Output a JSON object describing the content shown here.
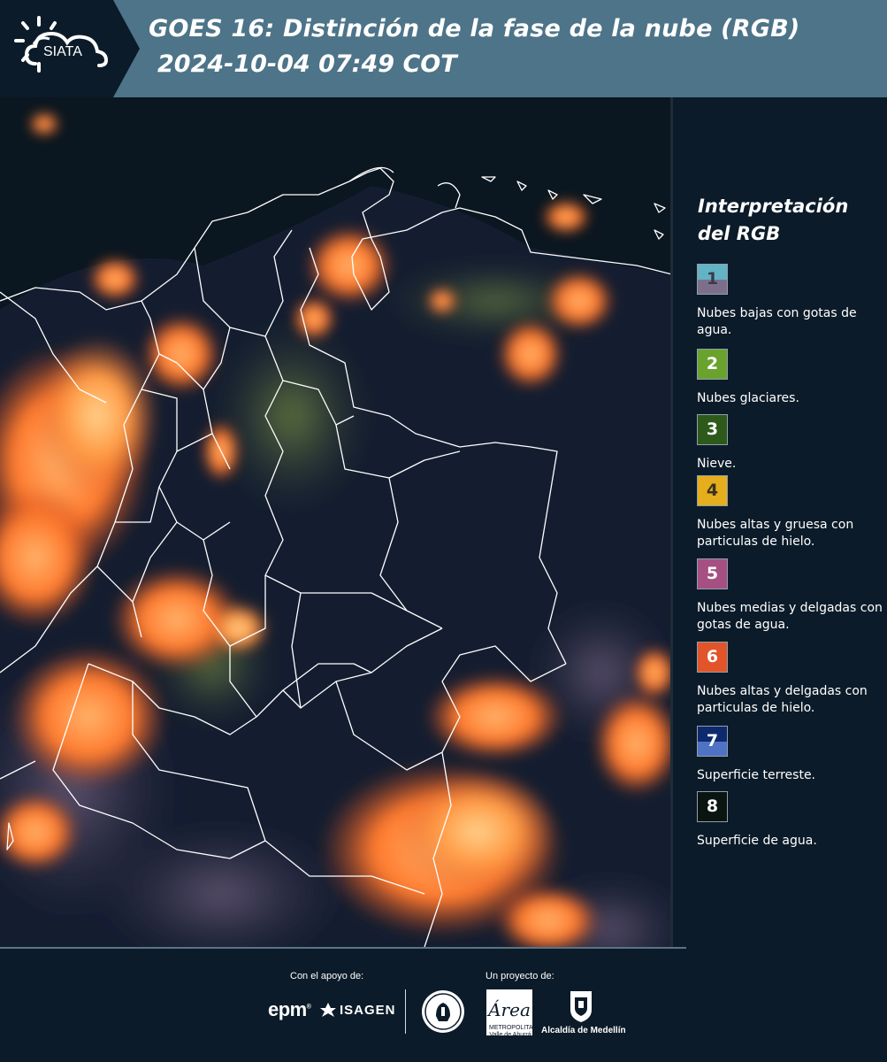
{
  "header": {
    "logo_text": "SIATA",
    "title": "GOES 16: Distinción de la fase de la nube (RGB)",
    "subtitle": "2024-10-04 07:49 COT",
    "background_color": "#4d7488",
    "logo_tab_color": "#0c1b29"
  },
  "legend": {
    "title": "Interpretación del RGB",
    "items": [
      {
        "number": "1",
        "description": "Nubes bajas con gotas de agua.",
        "top_color": "#62b3c4",
        "bottom_color": "#7d6f8c",
        "number_color": "#3a3a48"
      },
      {
        "number": "2",
        "description": "Nubes glaciares.",
        "top_color": "#6aa22e",
        "bottom_color": "#6aa22e",
        "number_color": "#ffffff"
      },
      {
        "number": "3",
        "description": "Nieve.",
        "top_color": "#2d5a1b",
        "bottom_color": "#2d5a1b",
        "number_color": "#ffffff"
      },
      {
        "number": "4",
        "description": "Nubes altas y gruesa con particulas de hielo.",
        "top_color": "#e6ad1c",
        "bottom_color": "#e6ad1c",
        "number_color": "#3a3220"
      },
      {
        "number": "5",
        "description": "Nubes medias y delgadas con gotas de agua.",
        "top_color": "#a64f82",
        "bottom_color": "#a64f82",
        "number_color": "#ffffff"
      },
      {
        "number": "6",
        "description": "Nubes altas y delgadas con particulas de hielo.",
        "top_color": "#e2542a",
        "bottom_color": "#e2542a",
        "number_color": "#ffffff"
      },
      {
        "number": "7",
        "description": "Superficie terreste.",
        "top_color": "#0e2a6e",
        "bottom_color": "#4f72c4",
        "number_color": "#ffffff"
      },
      {
        "number": "8",
        "description": "Superficie de agua.",
        "top_color": "#0a1410",
        "bottom_color": "#0a1410",
        "number_color": "#ffffff"
      }
    ]
  },
  "footer": {
    "support_label": "Con el apoyo de:",
    "project_label": "Un proyecto de:",
    "epm_text": "epm",
    "epm_mark": "®",
    "isagen_text": "ISAGEN",
    "area_text_1": "METROPOLITANA",
    "area_text_2": "Valle de Aburrá",
    "area_script": "Área",
    "medellin_text": "Alcaldía de Medellín"
  },
  "map": {
    "clouds_color": "#ff8a38",
    "land_color": "#1a2238",
    "water_color": "#0a141e",
    "border_color": "#ffffff"
  }
}
